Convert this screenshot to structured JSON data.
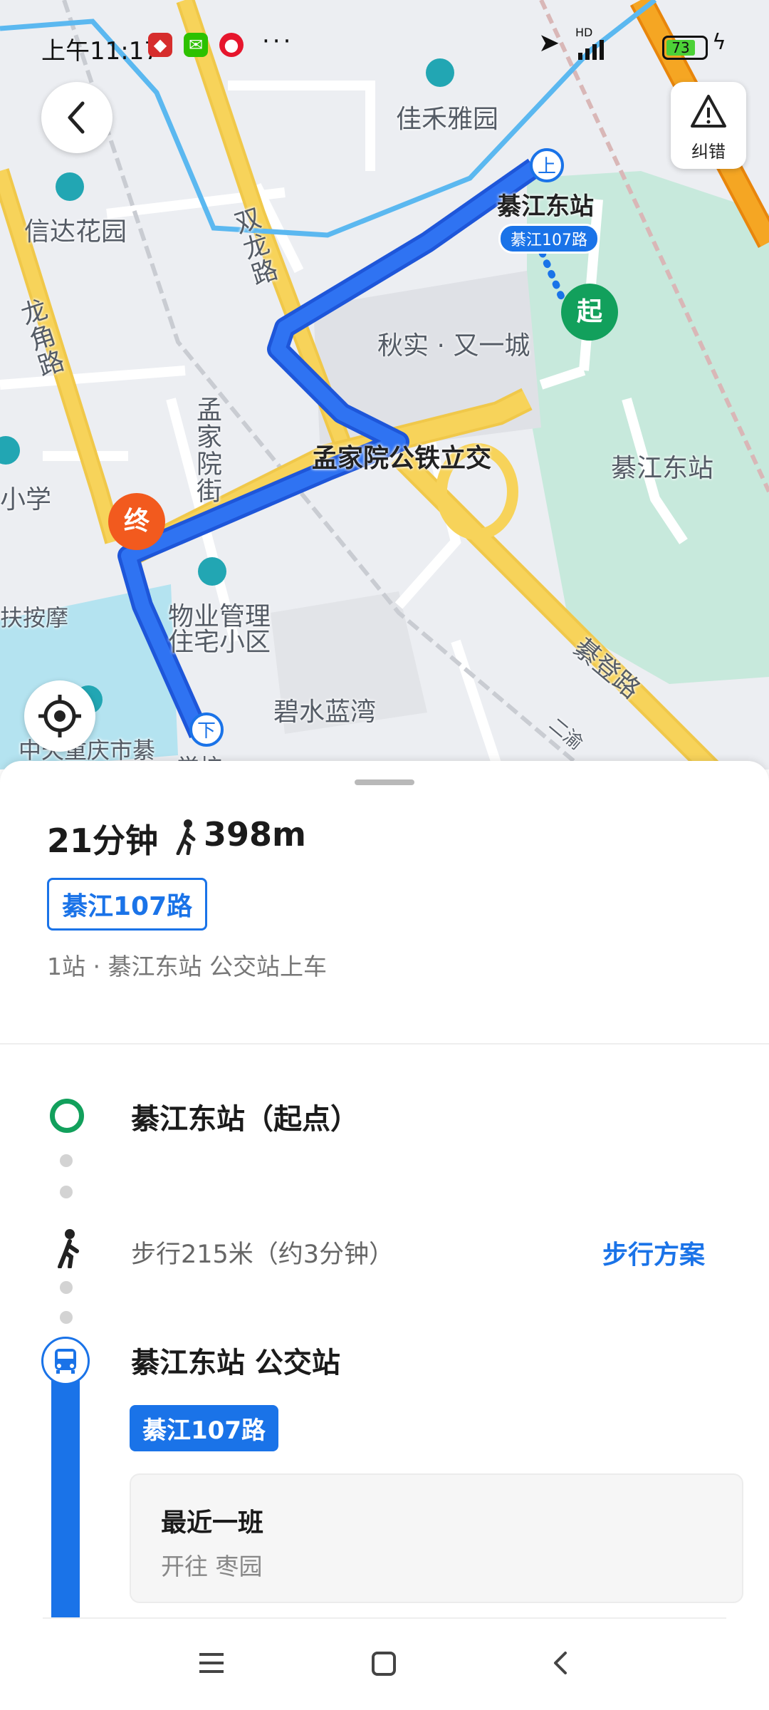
{
  "status_bar": {
    "time": "上午11:17",
    "more": "···",
    "battery": "73",
    "network": "HD"
  },
  "map": {
    "labels": {
      "jiahe": "佳禾雅园",
      "xinda": "信达花园",
      "shuanglong": "双龙路",
      "longjiao": "龙角路",
      "mengjiayuan_st": "孟家院街",
      "qiushi": "秋实 · 又一城",
      "mengjiayuan_jct": "孟家院公铁立交",
      "east_station_area": "綦江东站",
      "school": "小学",
      "massage": "扶按摩",
      "property": "物业管理",
      "residence": "住宅小区",
      "bishui": "碧水蓝湾",
      "qideng": "綦登路",
      "chongqing": "中天重庆市綦",
      "school2": "学校",
      "ercao": "二渝",
      "stop_name": "綦江东站",
      "route_tag": "綦江107路"
    },
    "board_badge": "上",
    "alight_badge": "下",
    "start_pin": "起",
    "end_pin": "终"
  },
  "report_button": {
    "label": "纠错"
  },
  "summary": {
    "duration": "21分钟",
    "walk_distance": "398m",
    "route": "綦江107路",
    "detail": "1站 · 綦江东站 公交站上车"
  },
  "steps": {
    "start_title": "綦江东站（起点）",
    "walk_text": "步行215米（约3分钟）",
    "walk_link": "步行方案",
    "stop_title": "綦江东站 公交站",
    "route_chip": "綦江107路",
    "next_title": "最近一班",
    "next_sub": "开往 枣园"
  },
  "colors": {
    "accent": "#1a73e8",
    "start": "#12a05c",
    "end": "#f25a1e",
    "road": "#f7d35a",
    "green": "#c7e9dc",
    "water": "#b4e3f0"
  }
}
